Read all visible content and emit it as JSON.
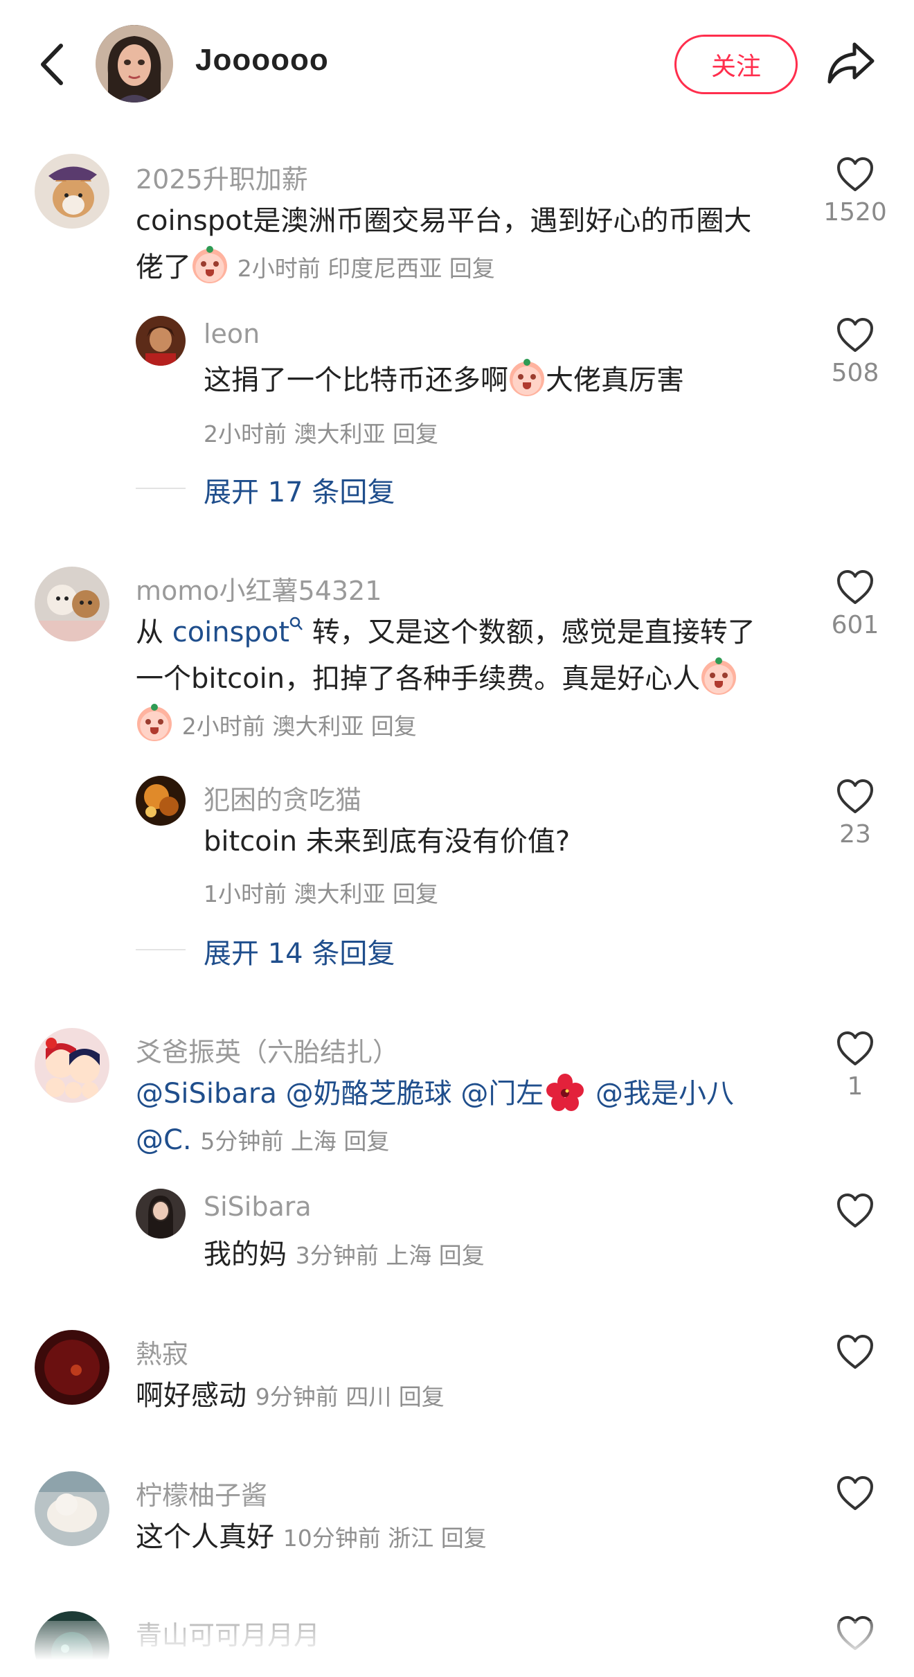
{
  "header": {
    "user_name": "Joooooo",
    "follow_label": "关注"
  },
  "comments": [
    {
      "user": "2025升职加薪",
      "text_line1": "coinspot是澳洲币圈交易平台，遇到好心的币圈大",
      "text_line2": "佬了",
      "meta": "2小时前 印度尼西亚 回复",
      "likes": "1520",
      "reply": {
        "user": "leon",
        "text_a": "这捐了一个比特币还多啊",
        "text_b": "大佬真厉害",
        "meta": "2小时前 澳大利亚 回复",
        "likes": "508"
      },
      "expand": "展开 17 条回复"
    },
    {
      "user": "momo小红薯54321",
      "text_line1_a": "从 ",
      "text_line1_link": "coinspot",
      "text_line1_b": " 转，又是这个数额，感觉是直接转了",
      "text_line2": "一个bitcoin，扣掉了各种手续费。真是好心人",
      "meta": "2小时前 澳大利亚 回复",
      "likes": "601",
      "reply": {
        "user": "犯困的贪吃猫",
        "text": "bitcoin 未来到底有没有价值?",
        "meta": "1小时前 澳大利亚 回复",
        "likes": "23"
      },
      "expand": "展开 14 条回复"
    },
    {
      "user": "爻爸振英（六胎结扎）",
      "mention1": "@SiSibara",
      "mention2": "@奶酪芝脆球",
      "mention3": "@门左",
      "mention4": "@我是小八",
      "mention5": "@C.",
      "meta": "5分钟前 上海 回复",
      "likes": "1",
      "reply": {
        "user": "SiSibara",
        "text": "我的妈",
        "meta": "3分钟前 上海 回复"
      }
    },
    {
      "user": "熱寂",
      "text": "啊好感动",
      "meta": "9分钟前 四川 回复"
    },
    {
      "user": "柠檬柚子酱",
      "text": "这个人真好",
      "meta": "10分钟前 浙江 回复"
    },
    {
      "user": "青山可可月月月"
    }
  ],
  "icons": {
    "back": "chevron-left-icon",
    "share": "share-arrow-icon",
    "like": "heart-outline-icon",
    "search_hint": "search-icon",
    "emoji": "crying-face-emoji",
    "flower": "hibiscus-emoji"
  },
  "colors": {
    "accent": "#ff2e4d",
    "mention": "#1f4e8c",
    "muted": "#9a9a9a"
  }
}
